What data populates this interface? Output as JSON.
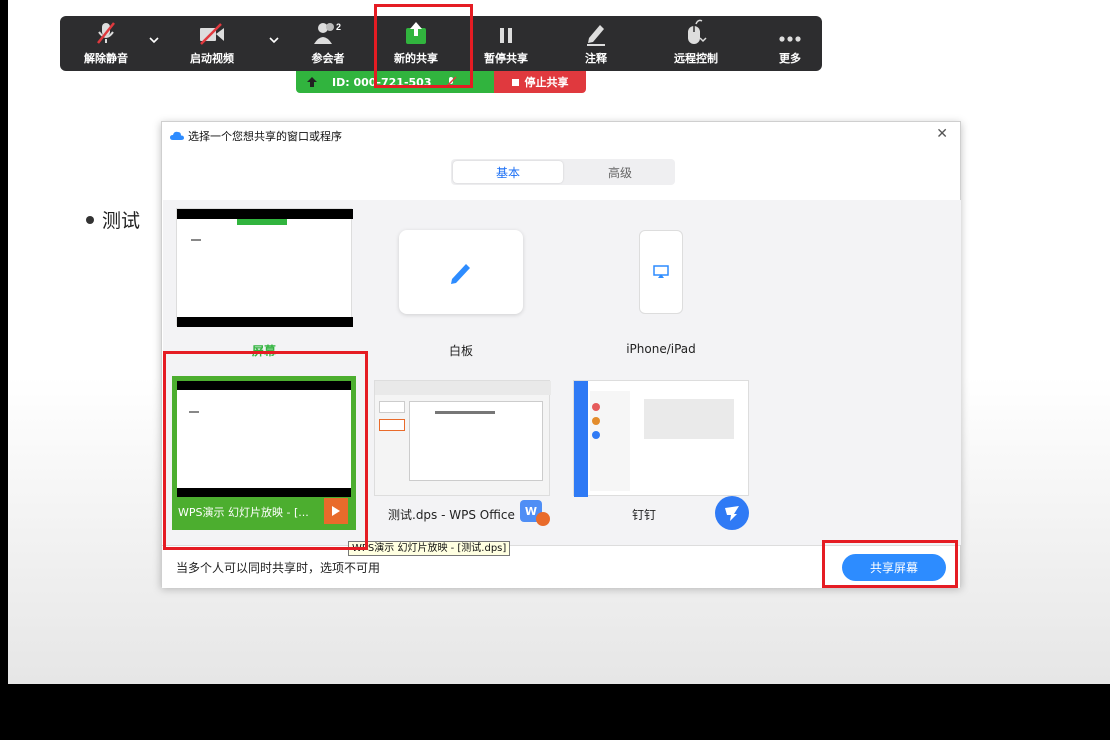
{
  "toolbar": {
    "items": [
      {
        "label": "解除静音",
        "icon": "mic-muted-icon"
      },
      {
        "label": "启动视频",
        "icon": "video-off-icon"
      },
      {
        "label": "参会者",
        "icon": "participants-icon",
        "count": "2"
      },
      {
        "label": "新的共享",
        "icon": "share-screen-icon"
      },
      {
        "label": "暂停共享",
        "icon": "pause-icon"
      },
      {
        "label": "注释",
        "icon": "annotate-pen-icon"
      },
      {
        "label": "远程控制",
        "icon": "remote-control-mouse-icon"
      },
      {
        "label": "更多",
        "icon": "more-icon"
      }
    ]
  },
  "share_bar": {
    "meeting_id": "ID: 000-721-503",
    "stop_label": "停止共享"
  },
  "slide": {
    "bullet_text": "测试"
  },
  "dialog": {
    "title": "选择一个您想共享的窗口或程序",
    "tabs": [
      {
        "label": "基本",
        "active": true
      },
      {
        "label": "高级",
        "active": false
      }
    ],
    "row1": [
      {
        "caption": "屏幕",
        "selected_caption": true
      },
      {
        "caption": "白板"
      },
      {
        "caption": "iPhone/iPad"
      }
    ],
    "row2": [
      {
        "caption": "WPS演示 幻灯片放映 - [..."
      },
      {
        "caption": "测试.dps - WPS Office"
      },
      {
        "caption": "钉钉"
      }
    ],
    "footer_text": "当多个人可以同时共享时，选项不可用",
    "share_button": "共享屏幕",
    "tooltip": "WPS演示 幻灯片放映 - [测试.dps]"
  },
  "colors": {
    "accent_blue": "#2d8cff",
    "zoom_green": "#31b43e",
    "stop_red": "#e0393e",
    "highlight_red": "#e51c23"
  }
}
